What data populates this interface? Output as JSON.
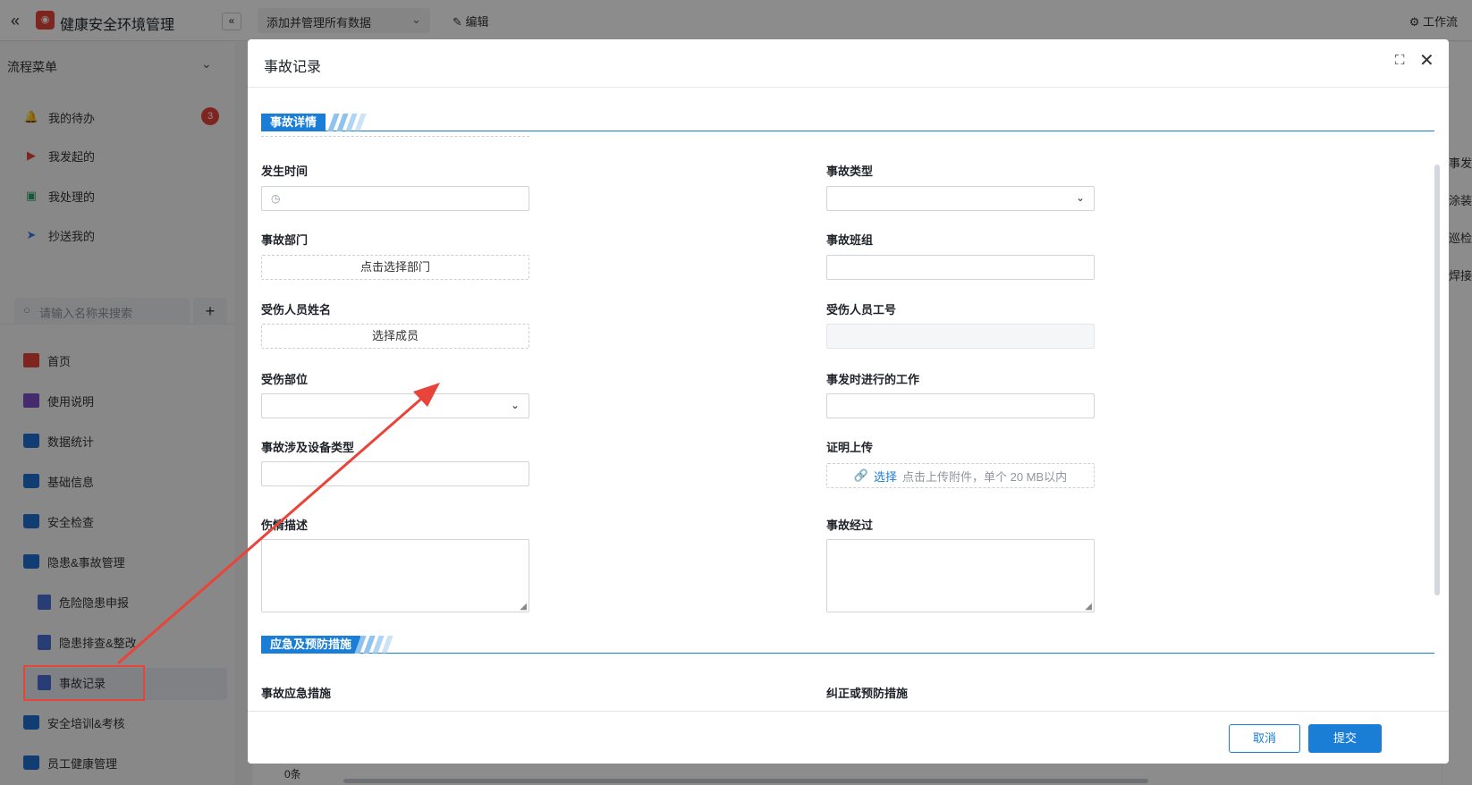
{
  "app": {
    "back_glyph": "«",
    "logo_glyph": "◉",
    "title": "健康安全环境管理",
    "collapse_glyph": "«",
    "view_select": "添加并管理所有数据",
    "edit_label": "编辑",
    "workflow_label": "工作流"
  },
  "flow_menu": {
    "header": "流程菜单",
    "items": [
      {
        "label": "我的待办",
        "icon": "bell-icon",
        "glyph": "🔔",
        "color": "#f5a623"
      },
      {
        "label": "我发起的",
        "icon": "play-icon",
        "glyph": "▶",
        "color": "#e8443a"
      },
      {
        "label": "我处理的",
        "icon": "check-box-icon",
        "glyph": "▣",
        "color": "#2e9e6a"
      },
      {
        "label": "抄送我的",
        "icon": "send-icon",
        "glyph": "➤",
        "color": "#3b78e7"
      }
    ],
    "todo_badge": "3"
  },
  "search": {
    "placeholder": "请输入名称来搜索",
    "add_glyph": "+"
  },
  "nav": [
    {
      "label": "首页",
      "icon": "home-icon",
      "type": "home"
    },
    {
      "label": "使用说明",
      "icon": "guide-icon",
      "type": "guide"
    },
    {
      "label": "数据统计",
      "icon": "folder-icon",
      "type": "folder"
    },
    {
      "label": "基础信息",
      "icon": "folder-icon",
      "type": "folder"
    },
    {
      "label": "安全检查",
      "icon": "folder-icon",
      "type": "folder"
    },
    {
      "label": "隐患&事故管理",
      "icon": "folder-open-icon",
      "type": "folder"
    },
    {
      "label": "危险隐患申报",
      "icon": "document-icon",
      "type": "doc"
    },
    {
      "label": "隐患排查&整改",
      "icon": "document-icon",
      "type": "doc"
    },
    {
      "label": "事故记录",
      "icon": "document-icon",
      "type": "doc",
      "active": true
    },
    {
      "label": "安全培训&考核",
      "icon": "folder-icon",
      "type": "folder"
    },
    {
      "label": "员工健康管理",
      "icon": "folder-icon",
      "type": "folder"
    }
  ],
  "right_peek": [
    "事发",
    "涂装",
    "巡检",
    "焊接"
  ],
  "table_peek": "0条",
  "modal": {
    "title": "事故记录",
    "expand_glyph": "⛶",
    "close_glyph": "✕",
    "section1": "事故详情",
    "section2": "应急及预防措施",
    "fields": {
      "occur_time": "发生时间",
      "accident_type": "事故类型",
      "dept": "事故部门",
      "dept_placeholder": "点击选择部门",
      "team": "事故班组",
      "injured_name": "受伤人员姓名",
      "injured_name_placeholder": "选择成员",
      "injured_id": "受伤人员工号",
      "injured_part": "受伤部位",
      "work_at_time": "事发时进行的工作",
      "equipment_type": "事故涉及设备类型",
      "proof_upload": "证明上传",
      "upload_pick": "选择",
      "upload_hint": "点击上传附件，单个 20 MB以内",
      "injury_desc": "伤情描述",
      "process": "事故经过",
      "emergency": "事故应急措施",
      "preventive": "纠正或预防措施"
    },
    "cancel": "取消",
    "submit": "提交"
  },
  "colors": {
    "primary": "#1a7dd6",
    "annotation": "#e8443a"
  }
}
